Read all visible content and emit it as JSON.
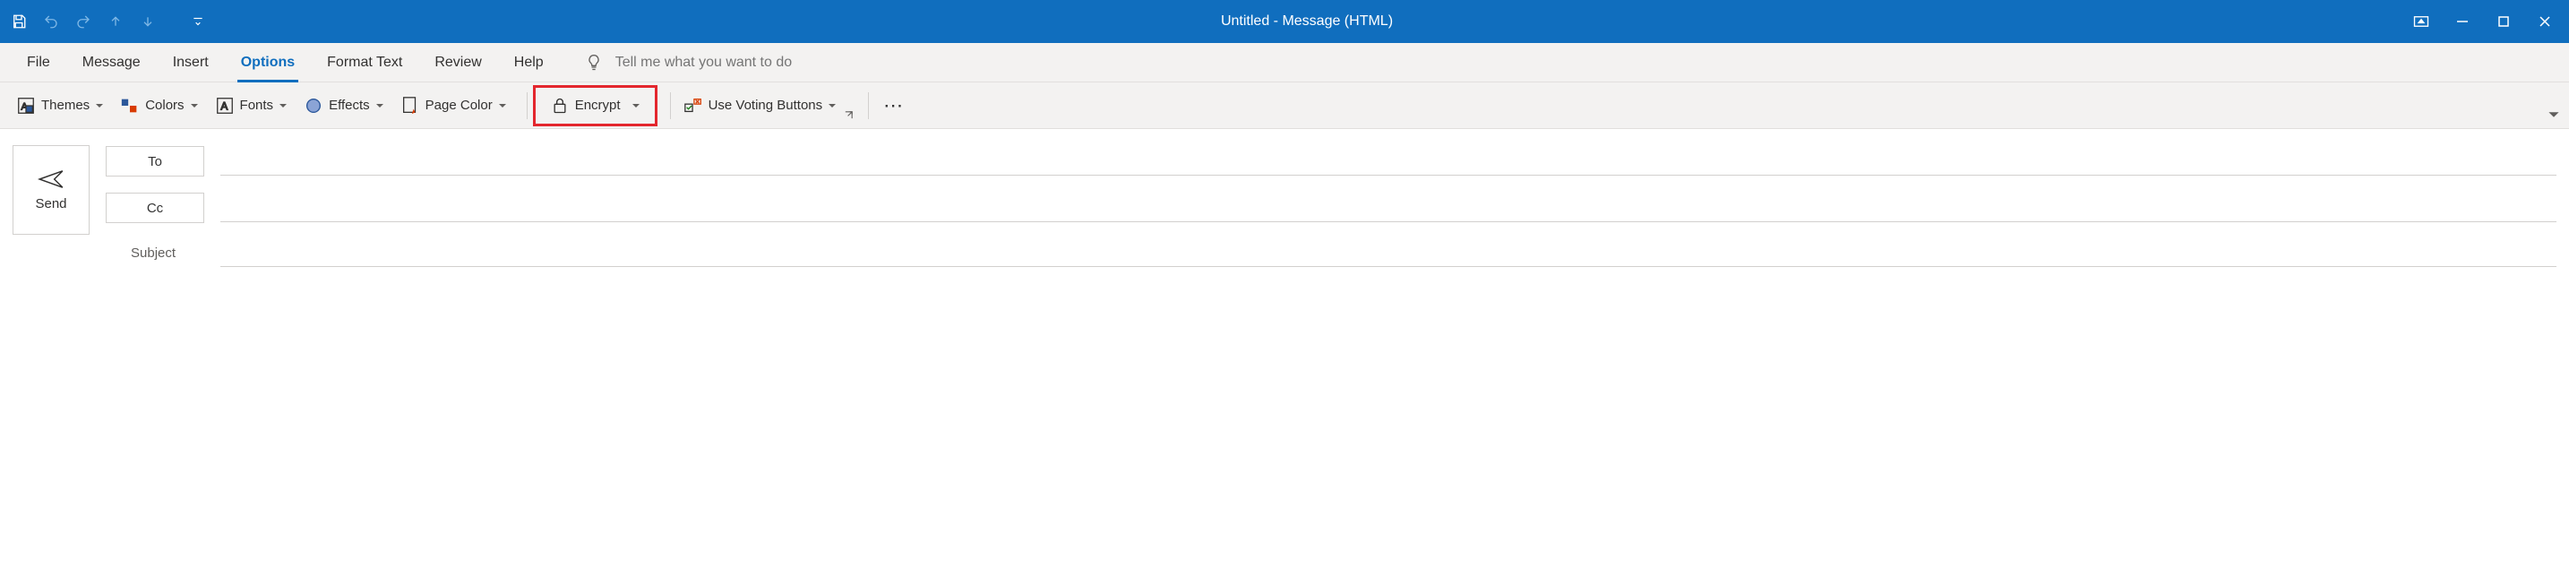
{
  "title": "Untitled  -  Message (HTML)",
  "tabs": {
    "file": "File",
    "message": "Message",
    "insert": "Insert",
    "options": "Options",
    "format_text": "Format Text",
    "review": "Review",
    "help": "Help"
  },
  "tellme_placeholder": "Tell me what you want to do",
  "ribbon": {
    "themes": "Themes",
    "colors": "Colors",
    "fonts": "Fonts",
    "effects": "Effects",
    "page_color": "Page Color",
    "encrypt": "Encrypt",
    "voting": "Use Voting Buttons"
  },
  "compose": {
    "send": "Send",
    "to": "To",
    "cc": "Cc",
    "subject_label": "Subject",
    "to_value": "",
    "cc_value": "",
    "subject_value": ""
  }
}
